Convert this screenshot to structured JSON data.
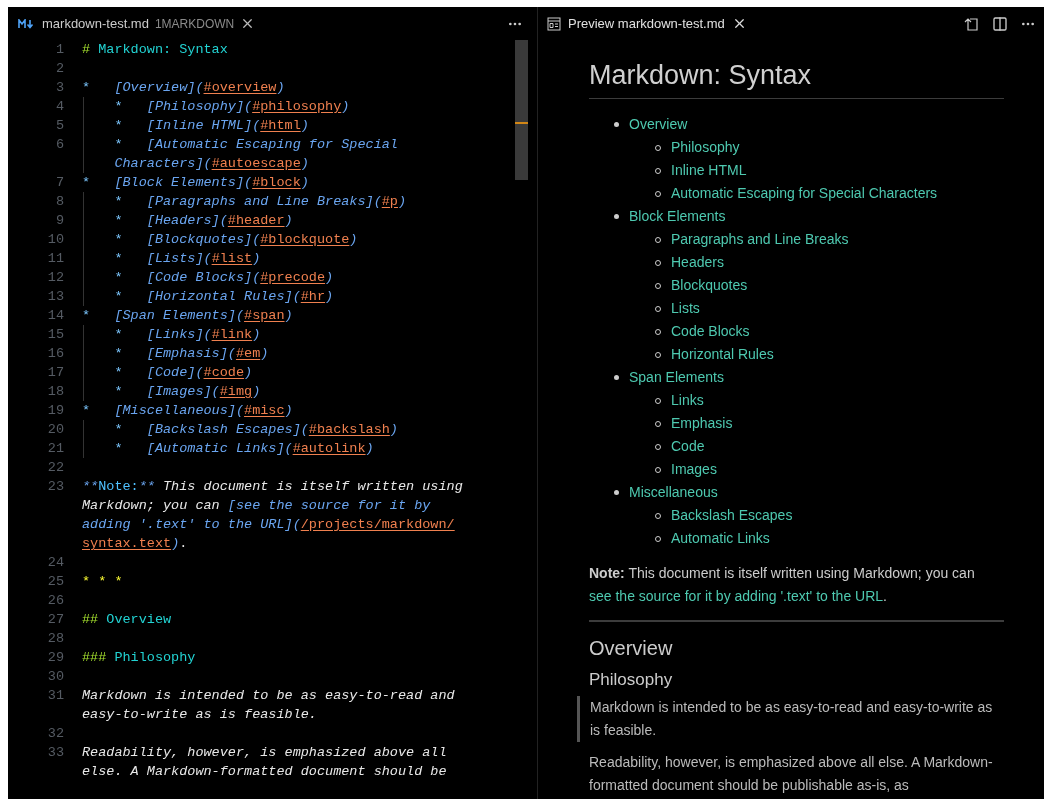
{
  "editor": {
    "tab": {
      "filename": "markdown-test.md",
      "badge": "1MARKDOWN"
    },
    "lines": [
      {
        "number": "1",
        "wrapped": [
          {
            "spans": [
              {
                "kind": "mark",
                "text": "# "
              },
              {
                "kind": "heading",
                "text": "Markdown: Syntax"
              }
            ]
          }
        ]
      },
      {
        "number": "2"
      },
      {
        "number": "3",
        "wrapped": [
          {
            "spans": [
              {
                "kind": "bullet",
                "text": "*   "
              },
              {
                "kind": "link",
                "text": "[Overview]("
              },
              {
                "kind": "url",
                "text": "#overview"
              },
              {
                "kind": "link",
                "text": ")"
              }
            ]
          }
        ]
      },
      {
        "number": "4",
        "wrapped": [
          {
            "spans": [
              {
                "kind": "bullet",
                "text": "    *   "
              },
              {
                "kind": "link",
                "text": "[Philosophy]("
              },
              {
                "kind": "url",
                "text": "#philosophy"
              },
              {
                "kind": "link",
                "text": ")"
              }
            ]
          }
        ]
      },
      {
        "number": "5",
        "wrapped": [
          {
            "spans": [
              {
                "kind": "bullet",
                "text": "    *   "
              },
              {
                "kind": "link",
                "text": "[Inline HTML]("
              },
              {
                "kind": "url",
                "text": "#html"
              },
              {
                "kind": "link",
                "text": ")"
              }
            ]
          }
        ]
      },
      {
        "number": "6",
        "wrapped": [
          {
            "spans": [
              {
                "kind": "bullet",
                "text": "    *   "
              },
              {
                "kind": "link",
                "text": "[Automatic Escaping for Special"
              }
            ]
          },
          {
            "spans": [
              {
                "kind": "link",
                "text": "    Characters]("
              },
              {
                "kind": "url",
                "text": "#autoescape"
              },
              {
                "kind": "link",
                "text": ")"
              }
            ]
          }
        ]
      },
      {
        "number": "7",
        "wrapped": [
          {
            "spans": [
              {
                "kind": "bullet",
                "text": "*   "
              },
              {
                "kind": "link",
                "text": "[Block Elements]("
              },
              {
                "kind": "url",
                "text": "#block"
              },
              {
                "kind": "link",
                "text": ")"
              }
            ]
          }
        ]
      },
      {
        "number": "8",
        "wrapped": [
          {
            "spans": [
              {
                "kind": "bullet",
                "text": "    *   "
              },
              {
                "kind": "link",
                "text": "[Paragraphs and Line Breaks]("
              },
              {
                "kind": "url",
                "text": "#p"
              },
              {
                "kind": "link",
                "text": ")"
              }
            ]
          }
        ]
      },
      {
        "number": "9",
        "wrapped": [
          {
            "spans": [
              {
                "kind": "bullet",
                "text": "    *   "
              },
              {
                "kind": "link",
                "text": "[Headers]("
              },
              {
                "kind": "url",
                "text": "#header"
              },
              {
                "kind": "link",
                "text": ")"
              }
            ]
          }
        ]
      },
      {
        "number": "10",
        "wrapped": [
          {
            "spans": [
              {
                "kind": "bullet",
                "text": "    *   "
              },
              {
                "kind": "link",
                "text": "[Blockquotes]("
              },
              {
                "kind": "url",
                "text": "#blockquote"
              },
              {
                "kind": "link",
                "text": ")"
              }
            ]
          }
        ]
      },
      {
        "number": "11",
        "wrapped": [
          {
            "spans": [
              {
                "kind": "bullet",
                "text": "    *   "
              },
              {
                "kind": "link",
                "text": "[Lists]("
              },
              {
                "kind": "url",
                "text": "#list"
              },
              {
                "kind": "link",
                "text": ")"
              }
            ]
          }
        ]
      },
      {
        "number": "12",
        "wrapped": [
          {
            "spans": [
              {
                "kind": "bullet",
                "text": "    *   "
              },
              {
                "kind": "link",
                "text": "[Code Blocks]("
              },
              {
                "kind": "url",
                "text": "#precode"
              },
              {
                "kind": "link",
                "text": ")"
              }
            ]
          }
        ]
      },
      {
        "number": "13",
        "wrapped": [
          {
            "spans": [
              {
                "kind": "bullet",
                "text": "    *   "
              },
              {
                "kind": "link",
                "text": "[Horizontal Rules]("
              },
              {
                "kind": "url",
                "text": "#hr"
              },
              {
                "kind": "link",
                "text": ")"
              }
            ]
          }
        ]
      },
      {
        "number": "14",
        "wrapped": [
          {
            "spans": [
              {
                "kind": "bullet",
                "text": "*   "
              },
              {
                "kind": "link",
                "text": "[Span Elements]("
              },
              {
                "kind": "url",
                "text": "#span"
              },
              {
                "kind": "link",
                "text": ")"
              }
            ]
          }
        ]
      },
      {
        "number": "15",
        "wrapped": [
          {
            "spans": [
              {
                "kind": "bullet",
                "text": "    *   "
              },
              {
                "kind": "link",
                "text": "[Links]("
              },
              {
                "kind": "url",
                "text": "#link"
              },
              {
                "kind": "link",
                "text": ")"
              }
            ]
          }
        ]
      },
      {
        "number": "16",
        "wrapped": [
          {
            "spans": [
              {
                "kind": "bullet",
                "text": "    *   "
              },
              {
                "kind": "link",
                "text": "[Emphasis]("
              },
              {
                "kind": "url",
                "text": "#em"
              },
              {
                "kind": "link",
                "text": ")"
              }
            ]
          }
        ]
      },
      {
        "number": "17",
        "wrapped": [
          {
            "spans": [
              {
                "kind": "bullet",
                "text": "    *   "
              },
              {
                "kind": "link",
                "text": "[Code]("
              },
              {
                "kind": "url",
                "text": "#code"
              },
              {
                "kind": "link",
                "text": ")"
              }
            ]
          }
        ]
      },
      {
        "number": "18",
        "wrapped": [
          {
            "spans": [
              {
                "kind": "bullet",
                "text": "    *   "
              },
              {
                "kind": "link",
                "text": "[Images]("
              },
              {
                "kind": "url",
                "text": "#img"
              },
              {
                "kind": "link",
                "text": ")"
              }
            ]
          }
        ]
      },
      {
        "number": "19",
        "wrapped": [
          {
            "spans": [
              {
                "kind": "bullet",
                "text": "*   "
              },
              {
                "kind": "link",
                "text": "[Miscellaneous]("
              },
              {
                "kind": "url",
                "text": "#misc"
              },
              {
                "kind": "link",
                "text": ")"
              }
            ]
          }
        ]
      },
      {
        "number": "20",
        "wrapped": [
          {
            "spans": [
              {
                "kind": "bullet",
                "text": "    *   "
              },
              {
                "kind": "link",
                "text": "[Backslash Escapes]("
              },
              {
                "kind": "url",
                "text": "#backslash"
              },
              {
                "kind": "link",
                "text": ")"
              }
            ]
          }
        ]
      },
      {
        "number": "21",
        "wrapped": [
          {
            "spans": [
              {
                "kind": "bullet",
                "text": "    *   "
              },
              {
                "kind": "link",
                "text": "[Automatic Links]("
              },
              {
                "kind": "url",
                "text": "#autolink"
              },
              {
                "kind": "link",
                "text": ")"
              }
            ]
          }
        ]
      },
      {
        "number": "22"
      },
      {
        "number": "23",
        "wrapped": [
          {
            "spans": [
              {
                "kind": "link",
                "text": "**"
              },
              {
                "kind": "note",
                "text": "Note:"
              },
              {
                "kind": "link",
                "text": "**"
              },
              {
                "kind": "italic",
                "text": " This document is itself written using"
              }
            ]
          },
          {
            "spans": [
              {
                "kind": "italic",
                "text": "Markdown; you can "
              },
              {
                "kind": "link",
                "text": "[see the source for it by"
              }
            ]
          },
          {
            "spans": [
              {
                "kind": "link",
                "text": "adding '.text' to the URL]("
              },
              {
                "kind": "url",
                "text": "/projects/markdown/"
              }
            ]
          },
          {
            "spans": [
              {
                "kind": "url",
                "text": "syntax.text"
              },
              {
                "kind": "link",
                "text": ")"
              },
              {
                "kind": "plain",
                "text": "."
              }
            ]
          }
        ]
      },
      {
        "number": "24"
      },
      {
        "number": "25",
        "wrapped": [
          {
            "spans": [
              {
                "kind": "hr",
                "text": "* * *"
              }
            ]
          }
        ]
      },
      {
        "number": "26"
      },
      {
        "number": "27",
        "wrapped": [
          {
            "spans": [
              {
                "kind": "mark",
                "text": "## "
              },
              {
                "kind": "heading",
                "text": "Overview"
              }
            ]
          }
        ]
      },
      {
        "number": "28"
      },
      {
        "number": "29",
        "wrapped": [
          {
            "spans": [
              {
                "kind": "mark",
                "text": "### "
              },
              {
                "kind": "heading",
                "text": "Philosophy"
              }
            ]
          }
        ]
      },
      {
        "number": "30"
      },
      {
        "number": "31",
        "wrapped": [
          {
            "spans": [
              {
                "kind": "italic",
                "text": "Markdown is intended to be as easy-to-read and"
              }
            ]
          },
          {
            "spans": [
              {
                "kind": "italic",
                "text": "easy-to-write as is feasible."
              }
            ]
          }
        ]
      },
      {
        "number": "32"
      },
      {
        "number": "33",
        "wrapped": [
          {
            "spans": [
              {
                "kind": "italic",
                "text": "Readability, however, is emphasized above all"
              }
            ]
          },
          {
            "spans": [
              {
                "kind": "italic",
                "text": "else. A Markdown-formatted document should be"
              }
            ]
          }
        ]
      }
    ]
  },
  "preview": {
    "tab": {
      "title": "Preview markdown-test.md"
    },
    "title": "Markdown: Syntax",
    "toc": [
      {
        "label": "Overview",
        "children": [
          {
            "label": "Philosophy"
          },
          {
            "label": "Inline HTML"
          },
          {
            "label": "Automatic Escaping for Special Characters"
          }
        ]
      },
      {
        "label": "Block Elements",
        "children": [
          {
            "label": "Paragraphs and Line Breaks"
          },
          {
            "label": "Headers"
          },
          {
            "label": "Blockquotes"
          },
          {
            "label": "Lists"
          },
          {
            "label": "Code Blocks"
          },
          {
            "label": "Horizontal Rules"
          }
        ]
      },
      {
        "label": "Span Elements",
        "children": [
          {
            "label": "Links"
          },
          {
            "label": "Emphasis"
          },
          {
            "label": "Code"
          },
          {
            "label": "Images"
          }
        ]
      },
      {
        "label": "Miscellaneous",
        "children": [
          {
            "label": "Backslash Escapes"
          },
          {
            "label": "Automatic Links"
          }
        ]
      }
    ],
    "note": [
      {
        "kind": "bold",
        "text": "Note:"
      },
      {
        "kind": "text",
        "text": " This document is itself written using Markdown; you can "
      },
      {
        "kind": "link",
        "text": "see the source for it by adding '.text' to the URL"
      },
      {
        "kind": "text",
        "text": "."
      }
    ],
    "h2": "Overview",
    "h3": "Philosophy",
    "blockquote": "Markdown is intended to be as easy-to-read and easy-to-write as is feasible.",
    "paragraph": "Readability, however, is emphasized above all else. A Markdown-formatted document should be publishable as-is, as"
  }
}
